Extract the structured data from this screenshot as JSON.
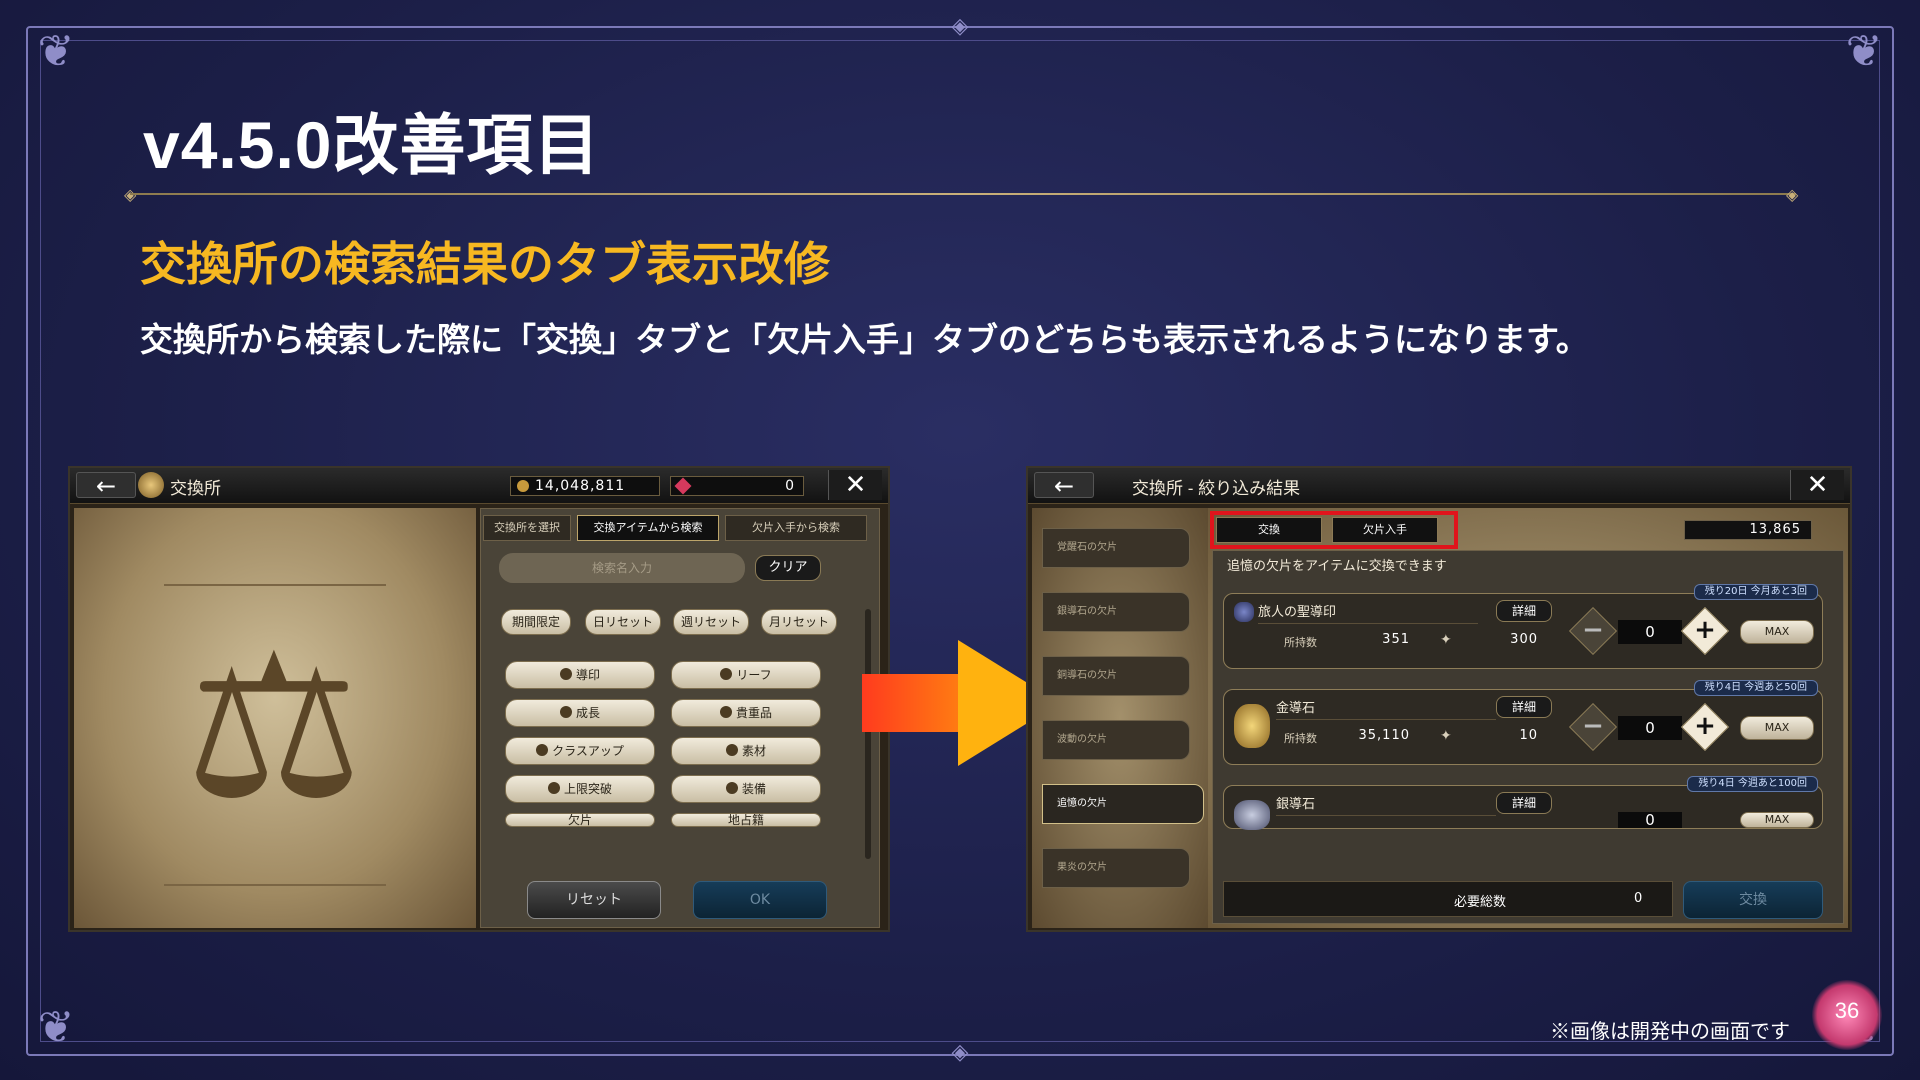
{
  "slide": {
    "title": "v4.5.0改善項目",
    "subtitle": "交換所の検索結果のタブ表示改修",
    "description": "交換所から検索した際に「交換」タブと「欠片入手」タブのどちらも表示されるようになります。",
    "note": "※画像は開発中の画面です",
    "page_number": "36"
  },
  "left_screen": {
    "back_label": "←",
    "close_label": "✕",
    "title": "交換所",
    "currency_gold": "14,048,811",
    "currency_gem": "0",
    "tabs": [
      "交換所を選択",
      "交換アイテムから検索",
      "欠片入手から検索"
    ],
    "active_tab": 1,
    "search_placeholder": "検索名入力",
    "clear_label": "クリア",
    "period_filters": [
      "期間限定",
      "日リセット",
      "週リセット",
      "月リセット"
    ],
    "categories": [
      "導印",
      "リーフ",
      "成長",
      "貴重品",
      "クラスアップ",
      "素材",
      "上限突破",
      "装備",
      "欠片",
      "地占籍"
    ],
    "reset_label": "リセット",
    "ok_label": "OK"
  },
  "right_screen": {
    "back_label": "←",
    "close_label": "✕",
    "title": "交換所 - 絞り込み結果",
    "tabs": [
      "交換",
      "欠片入手"
    ],
    "currency": "13,865",
    "sidebar": [
      "覚醒石の欠片",
      "銀導石の欠片",
      "銅導石の欠片",
      "波動の欠片",
      "追憶の欠片",
      "果炎の欠片"
    ],
    "active_sidebar": 4,
    "hint": "追憶の欠片をアイテムに交換できます",
    "rows": [
      {
        "tag": "残り20日 今月あと3回",
        "name": "旅人の聖導印",
        "detail": "詳細",
        "own_label": "所持数",
        "own": "351",
        "cost": "300",
        "qty": "0",
        "max": "MAX"
      },
      {
        "tag": "残り4日 今週あと50回",
        "name": "金導石",
        "detail": "詳細",
        "own_label": "所持数",
        "own": "35,110",
        "cost": "10",
        "qty": "0",
        "max": "MAX"
      },
      {
        "tag": "残り4日 今週あと100回",
        "name": "銀導石",
        "detail": "詳細",
        "own_label": "所持数",
        "own": "",
        "cost": "",
        "qty": "0",
        "max": "MAX"
      }
    ],
    "total_label": "必要総数",
    "total_value": "0",
    "exchange_label": "交換"
  },
  "colors": {
    "accent": "#f7b821",
    "highlight_box": "#e0141c",
    "arrow_start": "#ff3b1e",
    "arrow_end": "#ffb20f"
  }
}
